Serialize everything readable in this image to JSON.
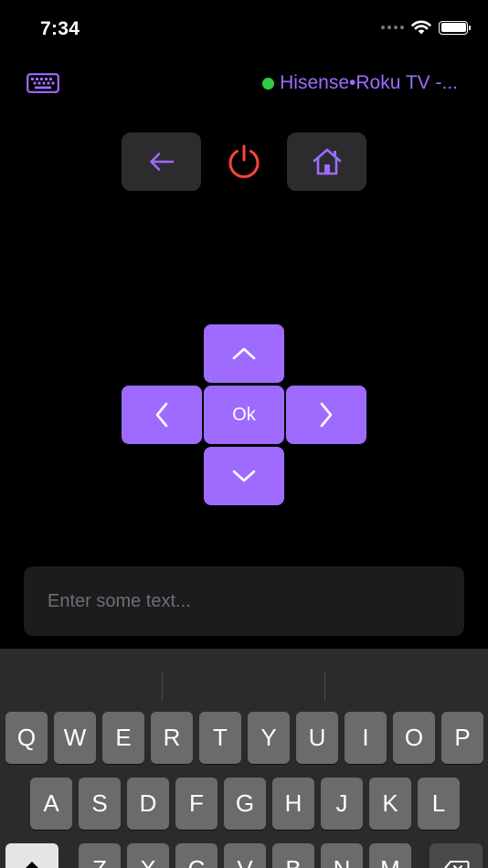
{
  "status_bar": {
    "time": "7:34"
  },
  "header": {
    "device_name": "Hisense•Roku TV -..."
  },
  "icons": {
    "keyboard": "keyboard-icon",
    "back": "arrow-left-icon",
    "power": "power-icon",
    "home": "home-icon",
    "up": "chevron-up-icon",
    "left": "chevron-left-icon",
    "right": "chevron-right-icon",
    "down": "chevron-down-icon"
  },
  "dpad": {
    "ok_label": "Ok"
  },
  "text_input": {
    "placeholder": "Enter some text...",
    "value": ""
  },
  "keyboard": {
    "row1": [
      "Q",
      "W",
      "E",
      "R",
      "T",
      "Y",
      "U",
      "I",
      "O",
      "P"
    ],
    "row2": [
      "A",
      "S",
      "D",
      "F",
      "G",
      "H",
      "J",
      "K",
      "L"
    ],
    "row3": [
      "Z",
      "X",
      "C",
      "V",
      "B",
      "N",
      "M"
    ]
  },
  "colors": {
    "accent": "#9F6BFF",
    "power": "#FF453A",
    "connected": "#2ECC40",
    "button_bg": "#2C2C2E",
    "keyboard_bg": "#2B2B2B"
  }
}
